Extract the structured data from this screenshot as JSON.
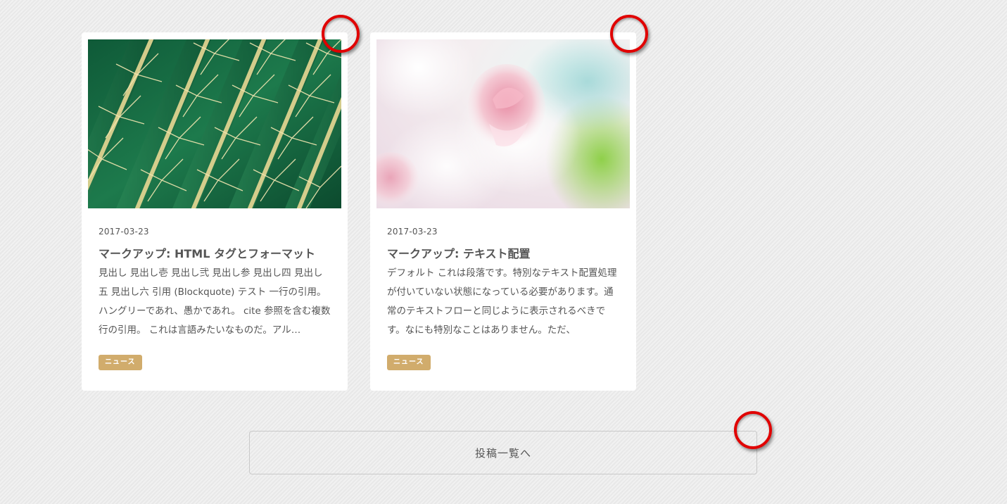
{
  "posts": [
    {
      "date": "2017-03-23",
      "title": "マークアップ: HTML タグとフォーマット",
      "excerpt": "見出し 見出し壱 見出し弐 見出し参 見出し四 見出し五 見出し六 引用 (Blockquote) テスト 一行の引用。ハングリーであれ、愚かであれ。 cite 参照を含む複数行の引用。 これは言語みたいなものだ。アル…",
      "tag": "ニュース",
      "image": "cactus-photo"
    },
    {
      "date": "2017-03-23",
      "title": "マークアップ: テキスト配置",
      "excerpt": "デフォルト これは段落です。特別なテキスト配置処理が付いていない状態になっている必要があります。通常のテキストフローと同じように表示されるべきです。なにも特別なことはありません。ただ、",
      "tag": "ニュース",
      "image": "rose-photo"
    }
  ],
  "more_button": {
    "label": "投稿一覧へ"
  },
  "colors": {
    "tag_background": "#d1ac6c",
    "marker": "#e00000",
    "text": "#555555"
  }
}
